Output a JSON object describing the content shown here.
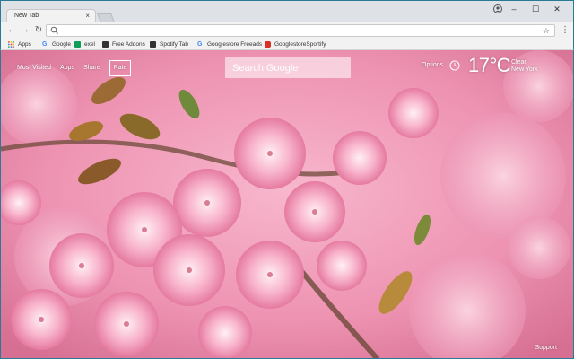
{
  "browser": {
    "tab_title": "New Tab",
    "tab_close": "×",
    "address_value": "",
    "window_controls": {
      "minimize": "–",
      "maximize": "☐",
      "close": "✕"
    },
    "star": "☆",
    "menu": "⋮"
  },
  "bookmarks": [
    {
      "label": "Apps",
      "icon": "apps-grid-icon",
      "color": "#ea4335"
    },
    {
      "label": "Google",
      "icon": "google-g-icon",
      "color": "#4285f4"
    },
    {
      "label": "exel",
      "icon": "sheets-icon",
      "color": "#0f9d58"
    },
    {
      "label": "Free Addons",
      "icon": "addons-icon",
      "color": "#333333"
    },
    {
      "label": "Spotify Tab",
      "icon": "spotify-tab-icon",
      "color": "#333333"
    },
    {
      "label": "Googlestore Freeads",
      "icon": "google-g-icon",
      "color": "#4285f4"
    },
    {
      "label": "GooglestoreSportify",
      "icon": "store-icon",
      "color": "#d93025"
    }
  ],
  "page": {
    "nav": {
      "most_visited": "Most Visited",
      "apps": "Apps",
      "share": "Share",
      "rate": "Rate"
    },
    "search_placeholder": "Search Google",
    "options": "Options",
    "temperature": "17°C",
    "weather_condition": "Clear",
    "weather_city": "New York",
    "support": "Support"
  },
  "colors": {
    "frame_border": "#2a7a96",
    "blossom_pink": "#f48fb1",
    "leaf_brown": "#8d6e3c"
  }
}
